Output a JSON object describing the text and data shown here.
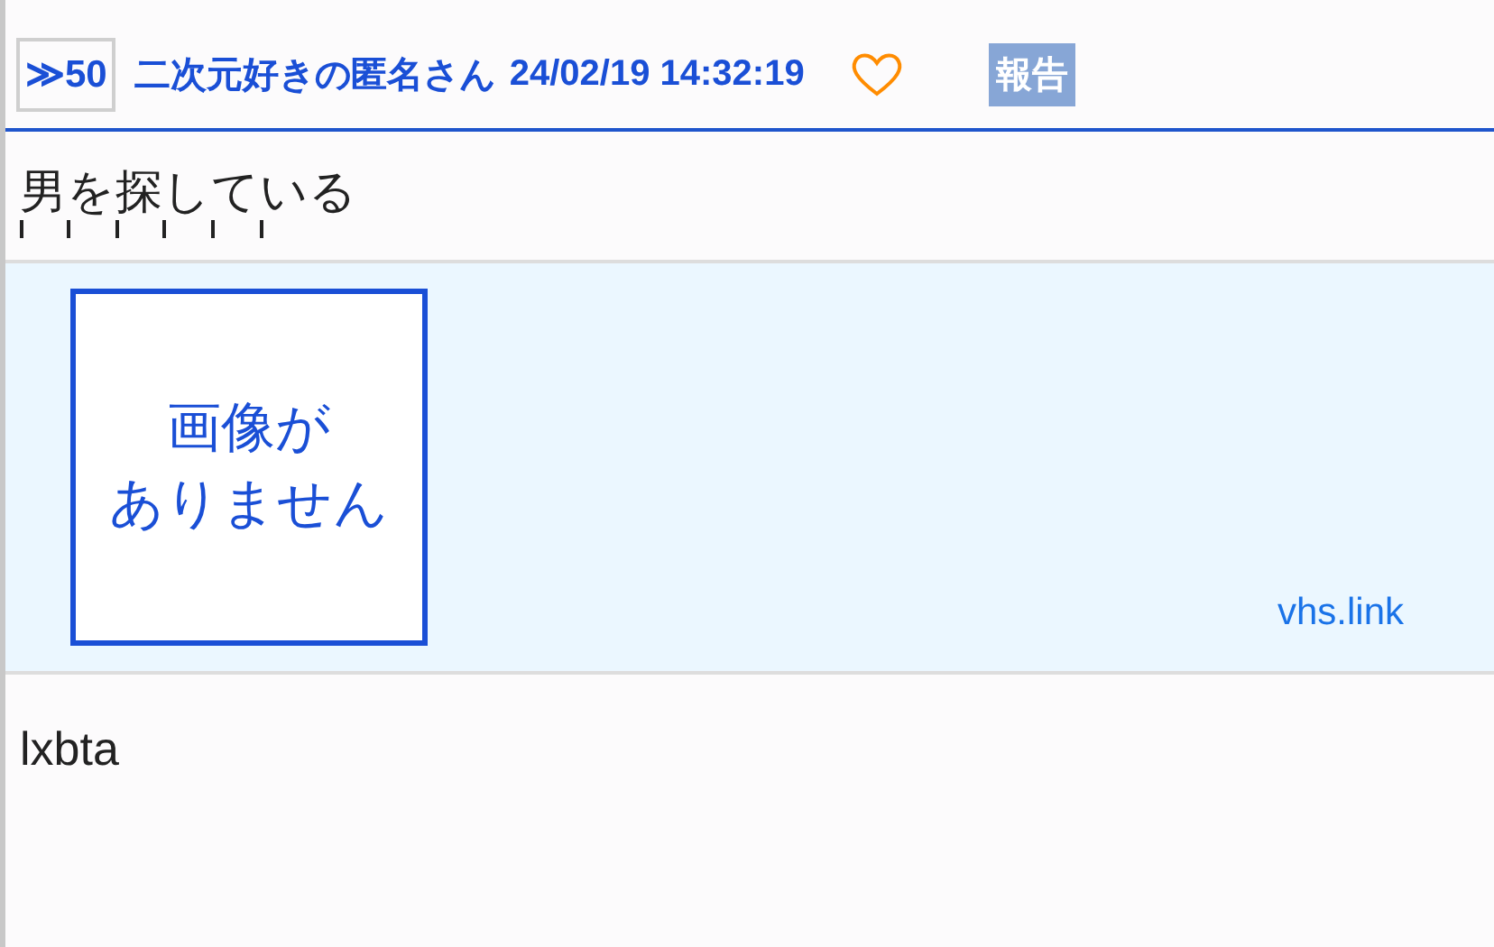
{
  "post": {
    "number": "≫50",
    "author": "二次元好きの匿名さん",
    "datetime": "24/02/19 14:32:19",
    "liked": false,
    "report_label": "報告"
  },
  "message": {
    "text": "男を探している",
    "emphasis": true
  },
  "link_preview": {
    "image_placeholder_lines": [
      "画像が",
      "ありません"
    ],
    "domain": "vhs.link"
  },
  "next_message": {
    "text": "lxbta"
  }
}
